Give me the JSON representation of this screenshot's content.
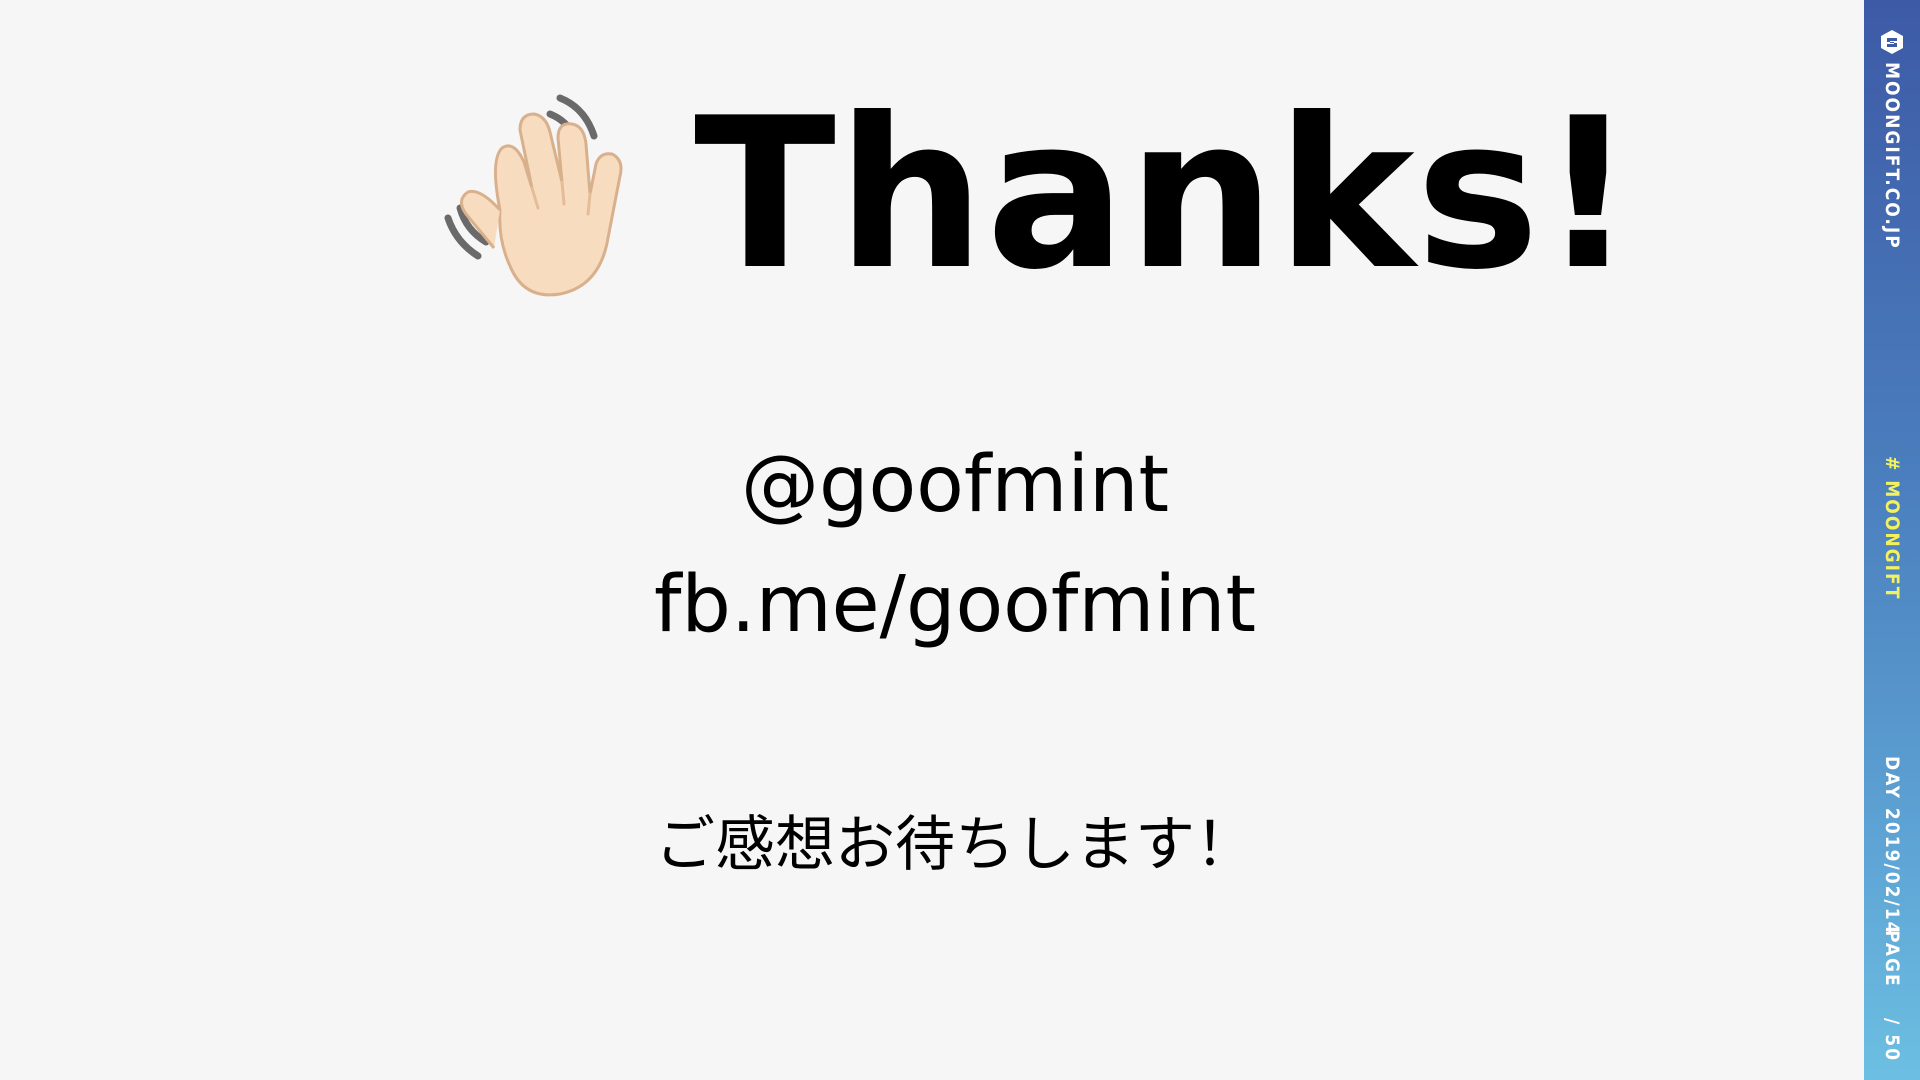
{
  "slide": {
    "title": "Thanks!",
    "twitter_handle": "@goofmint",
    "facebook_url": "fb.me/goofmint",
    "feedback_message": "ご感想お待ちします！",
    "title_icon": "waving-hand-icon"
  },
  "sidebar": {
    "brand": "MOONGIFT.CO.JP",
    "brand_icon": "moongift-logo-icon",
    "hashtag": "# MOONGIFT",
    "day_label": "DAY 2019/02/14",
    "page_label": "PAGE",
    "page_total": "/ 50"
  },
  "colors": {
    "background": "#f6f6f6",
    "band_top": "#3d5aa6",
    "band_bottom": "#6cbfe2",
    "hashtag": "#f4f15e"
  }
}
